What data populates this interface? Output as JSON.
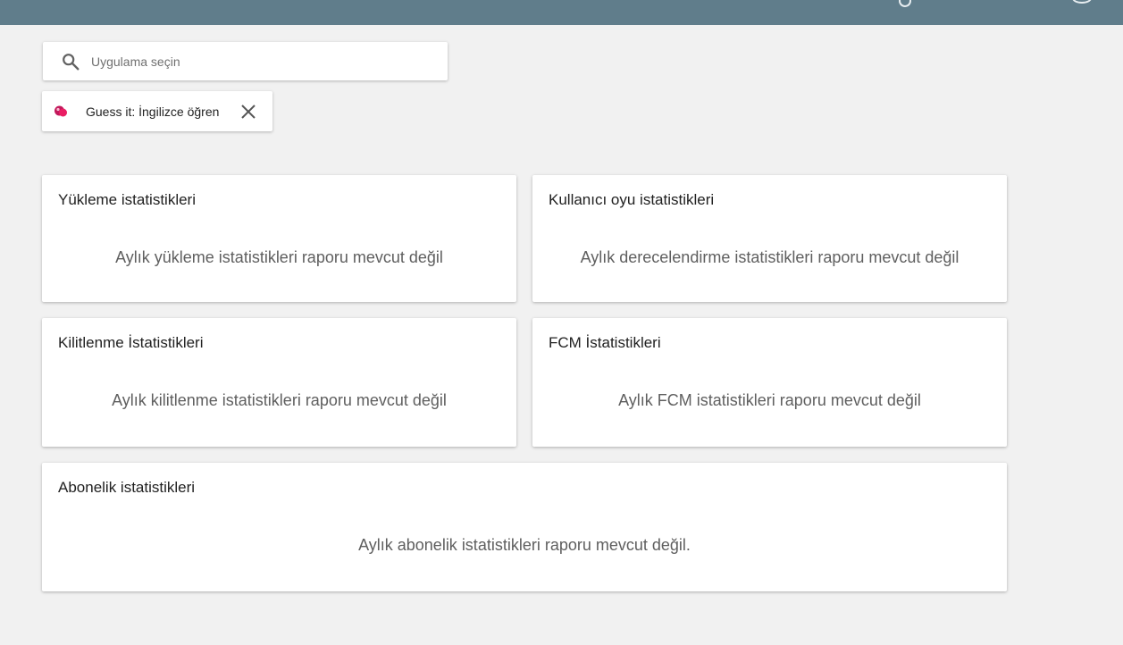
{
  "colors": {
    "topbar": "#607d8b",
    "background": "#f1f1f1",
    "card": "#ffffff",
    "app_icon": "#c2185b"
  },
  "topbar": {
    "icons": [
      "search-icon",
      "account-icon"
    ]
  },
  "search": {
    "placeholder": "Uygulama seçin",
    "value": "",
    "icon": "search-icon"
  },
  "selected_app": {
    "name": "Guess it: İngilizce öğren",
    "icon": "app-icon",
    "close_icon": "close-icon"
  },
  "cards": {
    "downloads": {
      "title": "Yükleme istatistikleri",
      "message": "Aylık yükleme istatistikleri raporu mevcut değil"
    },
    "ratings": {
      "title": "Kullanıcı oyu istatistikleri",
      "message": "Aylık derecelendirme istatistikleri raporu mevcut değil"
    },
    "crashes": {
      "title": "Kilitlenme İstatistikleri",
      "message": "Aylık kilitlenme istatistikleri raporu mevcut değil"
    },
    "fcm": {
      "title": "FCM İstatistikleri",
      "message": "Aylık FCM istatistikleri raporu mevcut değil"
    },
    "subscriptions": {
      "title": "Abonelik istatistikleri",
      "message": "Aylık abonelik istatistikleri raporu mevcut değil."
    }
  }
}
